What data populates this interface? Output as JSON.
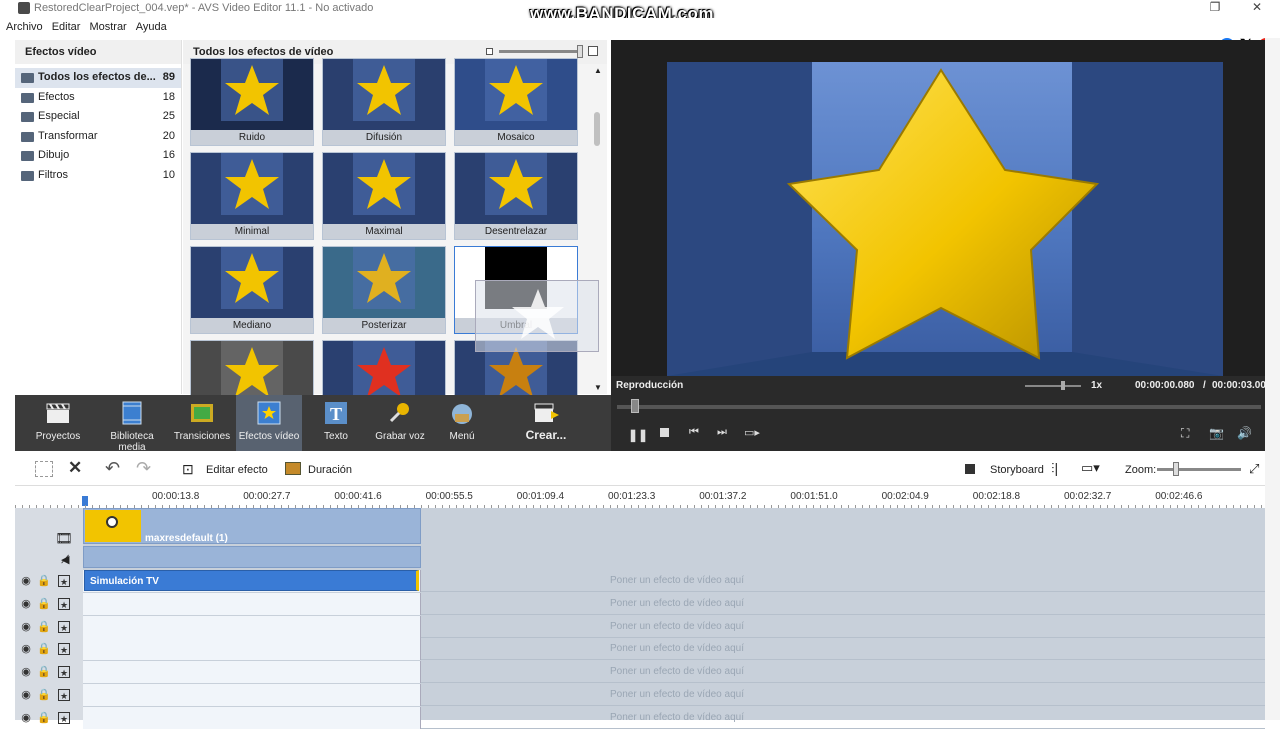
{
  "window": {
    "title": "RestoredClearProject_004.vep* - AVS Video Editor 11.1 - No activado",
    "watermark": "www.BANDICAM.com"
  },
  "menu": [
    "Archivo",
    "Editar",
    "Mostrar",
    "Ayuda"
  ],
  "left_panel": {
    "title": "Efectos vídeo",
    "categories": [
      {
        "label": "Todos los efectos de...",
        "count": "89"
      },
      {
        "label": "Efectos",
        "count": "18"
      },
      {
        "label": "Especial",
        "count": "25"
      },
      {
        "label": "Transformar",
        "count": "20"
      },
      {
        "label": "Dibujo",
        "count": "16"
      },
      {
        "label": "Filtros",
        "count": "10"
      }
    ]
  },
  "grid_panel": {
    "title": "Todos los efectos de vídeo",
    "tiles": [
      {
        "label": "Ruido"
      },
      {
        "label": "Difusión"
      },
      {
        "label": "Mosaico"
      },
      {
        "label": "Minimal"
      },
      {
        "label": "Maximal"
      },
      {
        "label": "Desentrelazar"
      },
      {
        "label": "Mediano"
      },
      {
        "label": "Posterizar"
      },
      {
        "label": "Umbral"
      },
      {
        "label": ""
      },
      {
        "label": ""
      },
      {
        "label": ""
      }
    ]
  },
  "preview": {
    "label": "Reproducción",
    "speed": "1x",
    "current_time": "00:00:00.080",
    "separator": "/",
    "total_time": "00:00:03.00"
  },
  "main_toolbar": [
    {
      "label": "Proyectos"
    },
    {
      "label": "Biblioteca media"
    },
    {
      "label": "Transiciones"
    },
    {
      "label": "Efectos vídeo"
    },
    {
      "label": "Texto"
    },
    {
      "label": "Grabar voz"
    },
    {
      "label": "Menú"
    },
    {
      "label": "Crear..."
    }
  ],
  "timeline_toolbar": {
    "edit_effect": "Editar efecto",
    "duration": "Duración",
    "storyboard": "Storyboard",
    "zoom": "Zoom:"
  },
  "ruler_ticks": [
    "00:00:13.8",
    "00:00:27.7",
    "00:00:41.6",
    "00:00:55.5",
    "00:01:09.4",
    "00:01:23.3",
    "00:01:37.2",
    "00:01:51.0",
    "00:02:04.9",
    "00:02:18.8",
    "00:02:32.7",
    "00:02:46.6"
  ],
  "tracks": {
    "video_clip": "maxresdefault (1)",
    "effect_clip": "Simulación TV",
    "effect_hint": "Poner un efecto de vídeo aquí"
  },
  "colors": {
    "accent": "#3a7bd5",
    "toolbar_bg": "#3b3b3b",
    "star": "#f2c400"
  }
}
